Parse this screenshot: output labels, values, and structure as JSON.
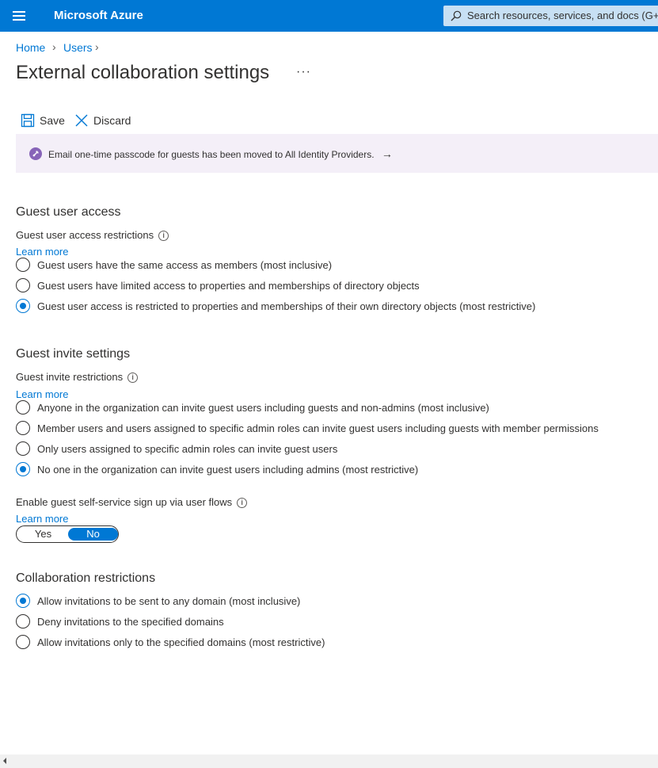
{
  "topbar": {
    "brand": "Microsoft Azure",
    "search_placeholder": "Search resources, services, and docs (G+/)"
  },
  "breadcrumb": [
    "Home",
    "Users"
  ],
  "page": {
    "title": "External collaboration settings",
    "more": "···"
  },
  "toolbar": {
    "save_label": "Save",
    "discard_label": "Discard"
  },
  "banner": {
    "text": "Email one-time passcode for guests has been moved to All Identity Providers.",
    "arrow": "→"
  },
  "guest_access": {
    "heading": "Guest user access",
    "label": "Guest user access restrictions",
    "learn_more": "Learn more",
    "options": [
      "Guest users have the same access as members (most inclusive)",
      "Guest users have limited access to properties and memberships of directory objects",
      "Guest user access is restricted to properties and memberships of their own directory objects (most restrictive)"
    ],
    "selected_index": 2
  },
  "guest_invite": {
    "heading": "Guest invite settings",
    "label": "Guest invite restrictions",
    "learn_more": "Learn more",
    "options": [
      "Anyone in the organization can invite guest users including guests and non-admins (most inclusive)",
      "Member users and users assigned to specific admin roles can invite guest users including guests with member permissions",
      "Only users assigned to specific admin roles can invite guest users",
      "No one in the organization can invite guest users including admins (most restrictive)"
    ],
    "selected_index": 3
  },
  "self_service": {
    "label": "Enable guest self-service sign up via user flows",
    "learn_more": "Learn more",
    "yes": "Yes",
    "no": "No",
    "value": "No"
  },
  "collab": {
    "heading": "Collaboration restrictions",
    "options": [
      "Allow invitations to be sent to any domain (most inclusive)",
      "Deny invitations to the specified domains",
      "Allow invitations only to the specified domains (most restrictive)"
    ],
    "selected_index": 0
  },
  "colors": {
    "accent": "#0078d4",
    "banner_bg": "#f4eff8",
    "banner_icon": "#8764b8"
  }
}
